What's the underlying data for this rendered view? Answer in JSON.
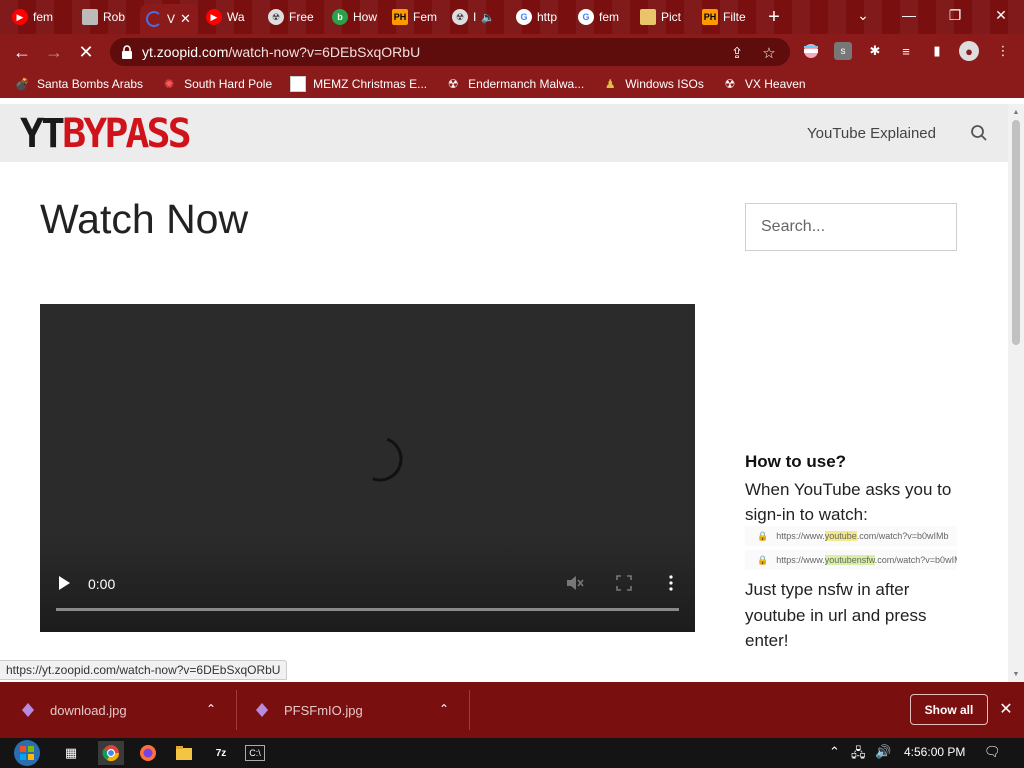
{
  "browser": {
    "tabs": [
      {
        "label": "fem",
        "icon": "youtube-icon",
        "color": "#ff0000"
      },
      {
        "label": "Rob",
        "icon": "roblox-icon",
        "color": "#cccccc"
      },
      {
        "label": "V",
        "icon": "loading-icon",
        "color": "#4a6ee0",
        "active": true
      },
      {
        "label": "Wa",
        "icon": "youtube-icon",
        "color": "#ff0000"
      },
      {
        "label": "Free",
        "icon": "vx-heaven-icon",
        "color": "#cccccc"
      },
      {
        "label": "How",
        "icon": "bing-icon",
        "color": "#2aa24a"
      },
      {
        "label": "Fem",
        "icon": "ph-icon",
        "color": "#f90"
      },
      {
        "label": "I",
        "icon": "vx-heaven-icon",
        "color": "#cccccc"
      },
      {
        "label": "http",
        "icon": "google-icon",
        "color": "#4285f4"
      },
      {
        "label": "fem",
        "icon": "google-icon",
        "color": "#4285f4"
      },
      {
        "label": "Pict",
        "icon": "image-icon",
        "color": "#e9c46a"
      },
      {
        "label": "Filte",
        "icon": "ph-icon",
        "color": "#f90"
      }
    ],
    "tab_ph_text": "PH",
    "url": {
      "host": "yt.zoopid.com",
      "path": "/watch-now?v=6DEbSxqORbU"
    },
    "bookmarks": [
      {
        "label": "Santa Bombs Arabs"
      },
      {
        "label": "South Hard Pole"
      },
      {
        "label": "MEMZ Christmas E..."
      },
      {
        "label": "Endermanch Malwa..."
      },
      {
        "label": "Windows ISOs"
      },
      {
        "label": "VX Heaven"
      }
    ],
    "profile_letter": "s"
  },
  "site": {
    "logo_part1": "YT",
    "logo_part2": "BYPASS",
    "menu_link": "YouTube Explained",
    "page_title": "Watch Now",
    "search_placeholder": "Search...",
    "video": {
      "time": "0:00"
    },
    "howto": {
      "heading": "How to use?",
      "intro": "When YouTube asks you to sign-in to watch:",
      "example1": {
        "prefix": "https://www.",
        "highlight": "youtube",
        "suffix": ".com/watch?v=b0wIMb"
      },
      "example2": {
        "prefix": "https://www.",
        "highlight": "youtubensfw",
        "suffix": ".com/watch?v=b0wIM"
      },
      "instructions": "Just type nsfw in after youtube in url and press enter!"
    },
    "status_url": "https://yt.zoopid.com/watch-now?v=6DEbSxqORbU"
  },
  "downloads": {
    "items": [
      {
        "name": "download.jpg"
      },
      {
        "name": "PFSFmIO.jpg"
      }
    ],
    "show_all": "Show all"
  },
  "taskbar": {
    "clock": "4:56:00 PM",
    "apps": [
      "task-view-icon",
      "chrome-icon",
      "firefox-icon",
      "file-explorer-icon",
      "7zip-icon",
      "cmd-icon"
    ],
    "seven_zip_label": "7z",
    "cmd_label": "C:\\"
  },
  "colors": {
    "theme": "#8b1a1a",
    "tabstrip": "#7a0f0f",
    "logo_red": "#d0121b"
  }
}
